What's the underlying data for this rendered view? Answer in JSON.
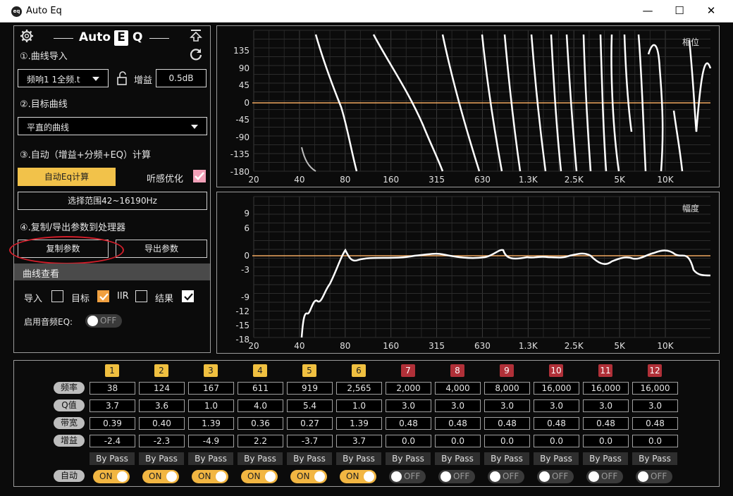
{
  "window": {
    "title": "Auto Eq",
    "app_icon": "eq",
    "minimize": "—",
    "maximize": "☐",
    "close": "✕"
  },
  "left_panel": {
    "logo": {
      "text1": "Auto",
      "letter": "E",
      "text2": "Q"
    },
    "step1": {
      "label": "①.曲线导入",
      "source_select": "频响1  1全频.t",
      "gain_label": "增益",
      "gain_value": "0.5dB"
    },
    "step2": {
      "label": "②.目标曲线",
      "target_select": "平直的曲线"
    },
    "step3": {
      "label": "③.自动（增益+分频+EQ）计算",
      "calc_button": "自动Eq计算",
      "optimize_label": "听感优化",
      "optimize_checked": true
    },
    "range_button": "选择范围42~16190Hz",
    "step4": {
      "label": "④.复制/导出参数到处理器",
      "copy_button": "复制参数",
      "export_button": "导出参数"
    },
    "curve_view": {
      "header": "曲线查看",
      "items": [
        {
          "label": "导入",
          "checked": false
        },
        {
          "label": "目标",
          "checked": true
        },
        {
          "label": "IIR",
          "checked": false
        },
        {
          "label": "结果",
          "checked": true
        }
      ],
      "audio_eq_label": "启用音频EQ:",
      "audio_eq_state": "OFF"
    }
  },
  "phase_chart": {
    "title": "相位",
    "y_ticks": [
      "135",
      "90",
      "45",
      "0",
      "-45",
      "-90",
      "-135",
      "-180"
    ],
    "x_ticks": [
      "20",
      "40",
      "80",
      "160",
      "315",
      "630",
      "1.3K",
      "2.5K",
      "5K",
      "10K"
    ]
  },
  "magnitude_chart": {
    "title": "幅度",
    "y_ticks": [
      "9",
      "6",
      "0",
      "-3",
      "-9",
      "-12",
      "-15",
      "-18"
    ],
    "x_ticks": [
      "20",
      "40",
      "80",
      "160",
      "315",
      "630",
      "1.3K",
      "2.5K",
      "5K",
      "10K"
    ]
  },
  "eq_table": {
    "row_labels": {
      "freq": "频率",
      "q": "Q值",
      "bw": "带宽",
      "gain": "增益",
      "auto": "自动"
    },
    "bypass_label": "By Pass",
    "colors": {
      "band_active": "#f0c040",
      "band_inactive": "#b03038"
    },
    "bands": [
      {
        "num": "1",
        "freq": "38",
        "q": "3.7",
        "bw": "0.39",
        "gain": "-2.4",
        "auto": "ON"
      },
      {
        "num": "2",
        "freq": "124",
        "q": "3.6",
        "bw": "0.40",
        "gain": "-2.3",
        "auto": "ON"
      },
      {
        "num": "3",
        "freq": "167",
        "q": "1.0",
        "bw": "1.39",
        "gain": "-4.9",
        "auto": "ON"
      },
      {
        "num": "4",
        "freq": "611",
        "q": "4.0",
        "bw": "0.36",
        "gain": "2.2",
        "auto": "ON"
      },
      {
        "num": "5",
        "freq": "919",
        "q": "5.4",
        "bw": "0.27",
        "gain": "-3.7",
        "auto": "ON"
      },
      {
        "num": "6",
        "freq": "2,565",
        "q": "1.0",
        "bw": "1.39",
        "gain": "3.7",
        "auto": "ON"
      },
      {
        "num": "7",
        "freq": "2,000",
        "q": "3.0",
        "bw": "0.48",
        "gain": "0.0",
        "auto": "OFF"
      },
      {
        "num": "8",
        "freq": "4,000",
        "q": "3.0",
        "bw": "0.48",
        "gain": "0.0",
        "auto": "OFF"
      },
      {
        "num": "9",
        "freq": "8,000",
        "q": "3.0",
        "bw": "0.48",
        "gain": "0.0",
        "auto": "OFF"
      },
      {
        "num": "10",
        "freq": "16,000",
        "q": "3.0",
        "bw": "0.48",
        "gain": "0.0",
        "auto": "OFF"
      },
      {
        "num": "11",
        "freq": "16,000",
        "q": "3.0",
        "bw": "0.48",
        "gain": "0.0",
        "auto": "OFF"
      },
      {
        "num": "12",
        "freq": "16,000",
        "q": "3.0",
        "bw": "0.48",
        "gain": "0.0",
        "auto": "OFF"
      }
    ]
  }
}
